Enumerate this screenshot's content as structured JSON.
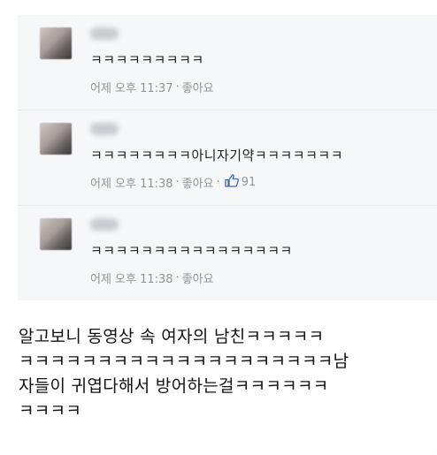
{
  "comments": [
    {
      "author": "",
      "text": "ㅋㅋㅋㅋㅋㅋㅋㅋㅋ",
      "time": "어제 오후 11:37",
      "like_label": "좋아요",
      "like_count": ""
    },
    {
      "author": "",
      "text": "ㅋㅋㅋㅋㅋㅋㅋㅋ아니자기약ㅋㅋㅋㅋㅋㅋㅋ",
      "time": "어제 오후 11:38",
      "like_label": "좋아요",
      "like_count": "91"
    },
    {
      "author": "",
      "text": "ㅋㅋㅋㅋㅋㅋㅋㅋㅋㅋㅋㅋㅋㅋㅋㅋ",
      "time": "어제 오후 11:38",
      "like_label": "좋아요",
      "like_count": ""
    }
  ],
  "caption": {
    "line1": "알고보니 동영상 속 여자의 남친ㅋㅋㅋㅋㅋ",
    "line2": "ㅋㅋㅋㅋㅋㅋㅋㅋㅋㅋㅋㅋㅋㅋㅋㅋㅋㅋㅋㅋ남",
    "line3": "자들이 귀엽다해서 방어하는걸ㅋㅋㅋㅋㅋㅋ",
    "line4": "ㅋㅋㅋㅋ"
  },
  "colors": {
    "comment_bg": "#f6f7f9",
    "meta_text": "#90949c",
    "like_icon": "#4267b2",
    "body_text": "#1d2129"
  },
  "icons": {
    "like": "thumbs-up-icon"
  }
}
